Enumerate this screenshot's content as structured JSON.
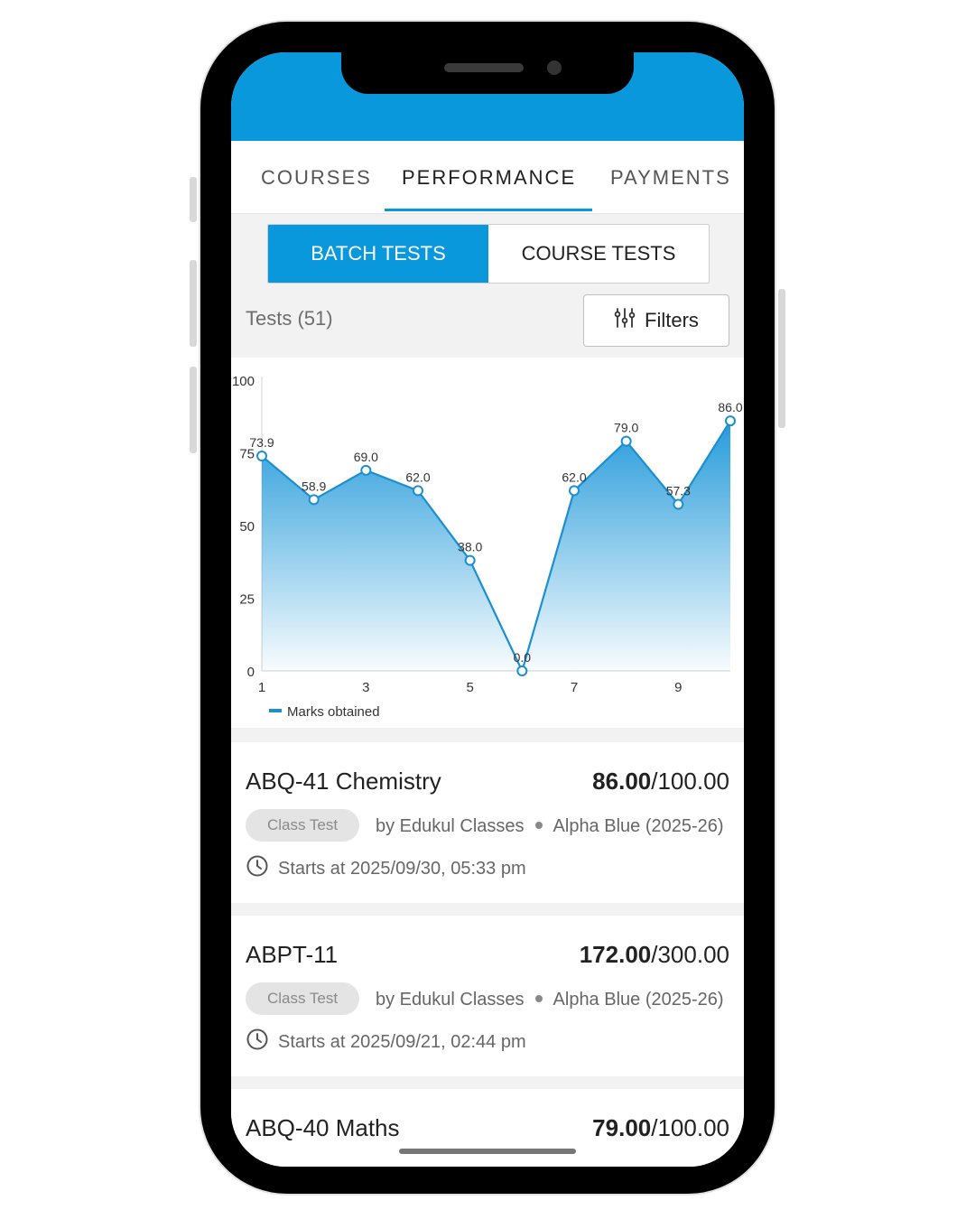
{
  "tabs": [
    {
      "label": "COURSES"
    },
    {
      "label": "PERFORMANCE"
    },
    {
      "label": "PAYMENTS"
    }
  ],
  "segmented": {
    "active": "BATCH TESTS",
    "inactive": "COURSE TESTS"
  },
  "tests_count": "Tests (51)",
  "filters_label": "Filters",
  "colors": {
    "accent": "#0a98dc",
    "header": "#0a98dc",
    "line": "#1b8fd0"
  },
  "icons": {
    "filters": "sliders-icon",
    "clock": "clock-icon"
  },
  "chart_data": {
    "type": "area",
    "x": [
      1,
      2,
      3,
      4,
      5,
      6,
      7,
      8,
      9,
      10
    ],
    "x_ticks": [
      "1",
      "3",
      "5",
      "7",
      "9"
    ],
    "y_ticks": [
      "0",
      "25",
      "50",
      "75",
      "100"
    ],
    "ylim": [
      0,
      100
    ],
    "series": [
      {
        "name": "Marks obtained",
        "values": [
          73.9,
          58.9,
          69.0,
          62.0,
          38.0,
          0.0,
          62.0,
          79.0,
          57.3,
          86.0
        ]
      }
    ],
    "data_labels": [
      "73.9",
      "58.9",
      "69.0",
      "62.0",
      "38.0",
      "0.0",
      "62.0",
      "79.0",
      "57.3",
      "86.0"
    ],
    "legend": "bottom-left",
    "grid": false
  },
  "cards": [
    {
      "title": "ABQ-41 Chemistry",
      "score": "86.00",
      "total": "/100.00",
      "chip": "Class Test",
      "by": "by Edukul Classes",
      "batch": "Alpha Blue (2025-26)",
      "starts": "Starts at 2025/09/30, 05:33 pm"
    },
    {
      "title": "ABPT-11",
      "score": "172.00",
      "total": "/300.00",
      "chip": "Class Test",
      "by": "by Edukul Classes",
      "batch": "Alpha Blue (2025-26)",
      "starts": "Starts at 2025/09/21, 02:44 pm"
    },
    {
      "title": "ABQ-40 Maths",
      "score": "79.00",
      "total": "/100.00"
    }
  ]
}
